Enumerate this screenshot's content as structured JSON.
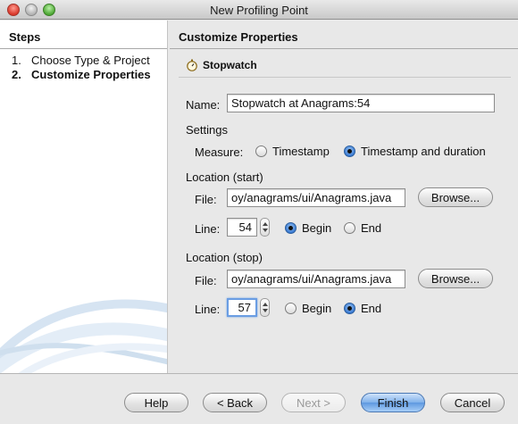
{
  "window": {
    "title": "New Profiling Point"
  },
  "steps": {
    "title": "Steps",
    "items": [
      {
        "number": "1.",
        "label": "Choose Type & Project"
      },
      {
        "number": "2.",
        "label": "Customize Properties"
      }
    ]
  },
  "main": {
    "title": "Customize Properties",
    "type_name": "Stopwatch",
    "type_icon": "stopwatch-icon",
    "name_label": "Name:",
    "name_value": "Stopwatch at Anagrams:54",
    "settings": {
      "title": "Settings",
      "measure_label": "Measure:",
      "options": [
        "Timestamp",
        "Timestamp and duration"
      ],
      "selected": "Timestamp and duration"
    },
    "location_start": {
      "title": "Location (start)",
      "file_label": "File:",
      "file_value": "oy/anagrams/ui/Anagrams.java",
      "browse_label": "Browse...",
      "line_label": "Line:",
      "line_value": "54",
      "begin_label": "Begin",
      "end_label": "End",
      "selected": "Begin"
    },
    "location_stop": {
      "title": "Location (stop)",
      "file_label": "File:",
      "file_value": "oy/anagrams/ui/Anagrams.java",
      "browse_label": "Browse...",
      "line_label": "Line:",
      "line_value": "57",
      "begin_label": "Begin",
      "end_label": "End",
      "selected": "End"
    }
  },
  "buttons": {
    "help": "Help",
    "back": "< Back",
    "next": "Next >",
    "finish": "Finish",
    "cancel": "Cancel"
  },
  "colors": {
    "accent": "#5e98e0",
    "window_bg": "#e8e8e8",
    "close": "#d9382b",
    "minimize": "#b3b3b3",
    "maximize": "#4da734"
  }
}
